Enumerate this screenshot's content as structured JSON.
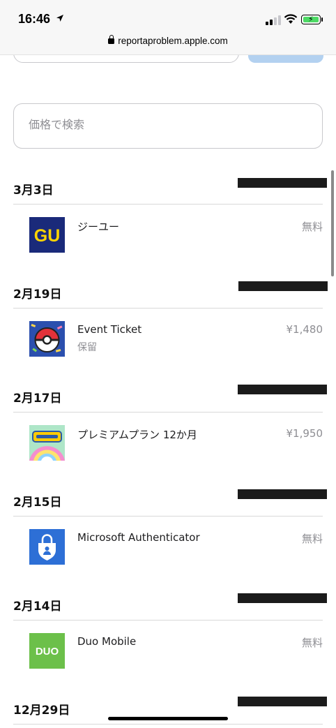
{
  "status_bar": {
    "time": "16:46",
    "icons": [
      "location-arrow-icon",
      "cellular-signal-icon",
      "wifi-icon",
      "battery-charging-icon"
    ],
    "url": "reportaproblem.apple.com"
  },
  "search": {
    "placeholder": "価格で検索"
  },
  "purchases": [
    {
      "date": "3月3日",
      "app": "ジーユー",
      "subtitle": "",
      "price": "無料",
      "icon": "gu-app-icon"
    },
    {
      "date": "2月19日",
      "app": "Event Ticket",
      "subtitle": "保留",
      "price": "¥1,480",
      "icon": "pokemon-go-app-icon"
    },
    {
      "date": "2月17日",
      "app": "プレミアムプラン 12か月",
      "subtitle": "",
      "price": "¥1,950",
      "icon": "pokemon-app-icon"
    },
    {
      "date": "2月15日",
      "app": "Microsoft Authenticator",
      "subtitle": "",
      "price": "無料",
      "icon": "microsoft-authenticator-app-icon"
    },
    {
      "date": "2月14日",
      "app": "Duo Mobile",
      "subtitle": "",
      "price": "無料",
      "icon": "duo-mobile-app-icon"
    },
    {
      "date": "12月29日",
      "app": "",
      "subtitle": "",
      "price": "",
      "icon": ""
    }
  ],
  "icon_texts": {
    "gu": "GU",
    "duo": "DUO"
  },
  "colors": {
    "accent": "#b3d1f0",
    "gu_navy": "#1a2a7a",
    "gu_yellow": "#ffd400",
    "ms_blue": "#2d6fd6",
    "duo_green": "#6cc04a"
  }
}
